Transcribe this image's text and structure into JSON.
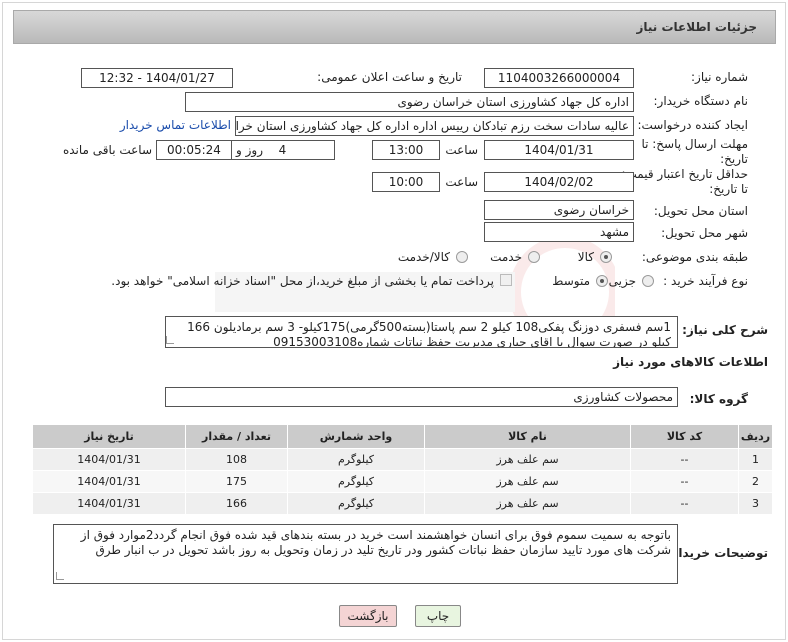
{
  "header": {
    "title": "جزئیات اطلاعات نیاز"
  },
  "fields": {
    "need_number_label": "شماره نیاز:",
    "need_number": "1104003266000004",
    "announce_label": "تاریخ و ساعت اعلان عمومی:",
    "announce_value": "1404/01/27 - 12:32",
    "buyer_org_label": "نام دستگاه خریدار:",
    "buyer_org": "اداره کل جهاد کشاورزی استان خراسان رضوی",
    "creator_label": "ایجاد کننده درخواست:",
    "creator": "عالیه سادات سخت رزم تبادکان رییس اداره  اداره کل جهاد کشاورزی استان خراسان رضوی",
    "contact_link": "اطلاعات تماس خریدار",
    "send_deadline_label_1": "مهلت ارسال پاسخ: تا",
    "send_deadline_label_2": "تاریخ:",
    "send_date": "1404/01/31",
    "time_label": "ساعت",
    "send_time": "13:00",
    "days_value": "4",
    "days_label": "روز و",
    "remaining_time": "00:05:24",
    "remaining_label": "ساعت باقی مانده",
    "validity_label_1": "حداقل تاریخ اعتبار قیمت:",
    "validity_label_2": "تا تاریخ:",
    "validity_date": "1404/02/02",
    "validity_time_label": "ساعت",
    "validity_time": "10:00",
    "province_label": "استان محل تحویل:",
    "province": "خراسان رضوی",
    "city_label": "شهر محل تحویل:",
    "city": "مشهد",
    "category_label": "طبقه بندی موضوعی:",
    "category_options": [
      "کالا",
      "خدمت",
      "کالا/خدمت"
    ],
    "process_label": "نوع فرآیند خرید :",
    "process_options": [
      "جزیی",
      "متوسط"
    ],
    "payment_note": "پرداخت تمام یا بخشی از مبلغ خرید،از محل \"اسناد خزانه اسلامی\" خواهد بود.",
    "description_label": "شرح کلی نیاز:",
    "description": "1سم فسفری دوزنگ پفکی108 کیلو 2 سم پاستا(بسته500گرمی)175کیلو- 3 سم برمادیلون 166 کیلو در صورت سوال با اقای جباری مدیریت حفظ نباتات شماره09153003108",
    "goods_info_title": "اطلاعات کالاهای مورد نیاز",
    "goods_group_label": "گروه کالا:",
    "goods_group": "محصولات کشاورزی",
    "buyer_notes_label": "توضیحات خریدار:",
    "buyer_notes": "باتوجه به سمیت سموم فوق برای انسان خواهشمند است خرید در بسته بندهای قید شده فوق انجام گردد2موارد فوق از شرکت های مورد تایید سازمان حفظ نباتات کشور ودر تاریخ تلید در زمان وتحویل به روز باشد تحویل در ب انبار طرق"
  },
  "table": {
    "headers": [
      "ردیف",
      "کد کالا",
      "نام کالا",
      "واحد شمارش",
      "تعداد / مقدار",
      "تاریخ نیاز"
    ],
    "rows": [
      {
        "row": "1",
        "code": "--",
        "name": "سم علف هرز",
        "unit": "کیلوگرم",
        "qty": "108",
        "date": "1404/01/31"
      },
      {
        "row": "2",
        "code": "--",
        "name": "سم علف هرز",
        "unit": "کیلوگرم",
        "qty": "175",
        "date": "1404/01/31"
      },
      {
        "row": "3",
        "code": "--",
        "name": "سم علف هرز",
        "unit": "کیلوگرم",
        "qty": "166",
        "date": "1404/01/31"
      }
    ]
  },
  "buttons": {
    "print": "چاپ",
    "back": "بازگشت"
  },
  "colors": {
    "back_button_bg": "#f4d4d4",
    "print_button_bg": "#e8f5e0",
    "link": "#1a4cab"
  }
}
